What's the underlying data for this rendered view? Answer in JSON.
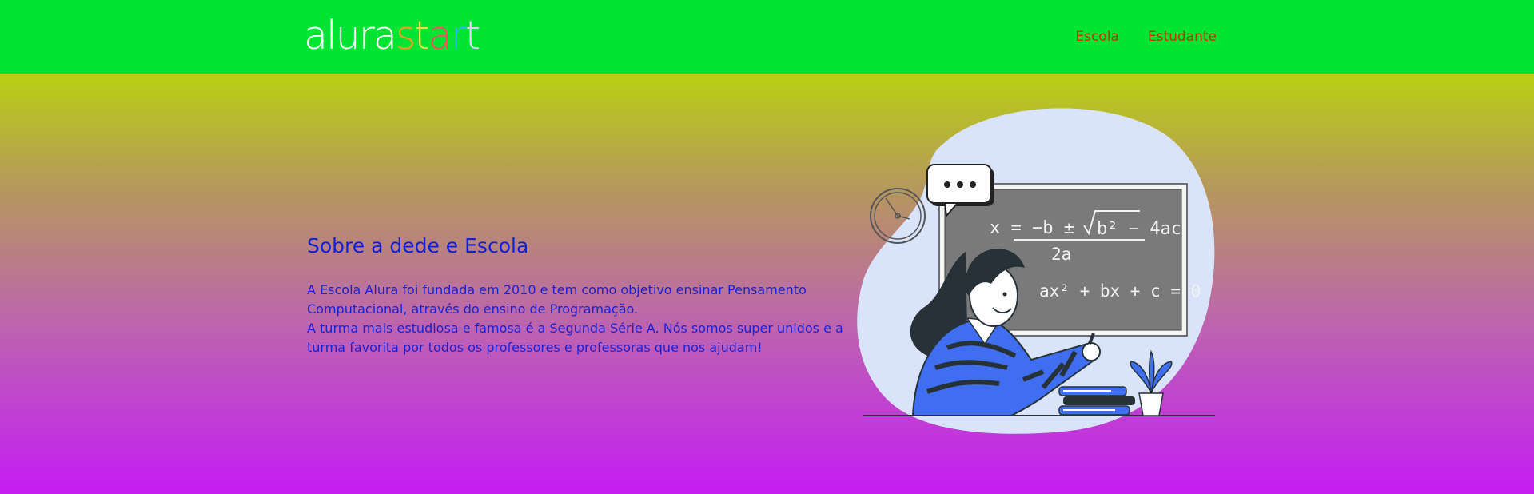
{
  "header": {
    "logo": {
      "part_white": "alura",
      "part_colored": [
        "s",
        "t",
        "a",
        "r",
        "t"
      ],
      "colors": [
        "#ff9b1f",
        "#f9e045",
        "#ff4e5e",
        "#29b6f6",
        "#e6d2ff"
      ]
    },
    "nav": [
      {
        "label": "Escola"
      },
      {
        "label": "Estudante"
      }
    ],
    "background": "#00e534"
  },
  "main": {
    "title": "Sobre a dede e Escola",
    "paragraph1": "A Escola Alura foi fundada em 2010 e tem como objetivo ensinar Pensamento Computacional, através do ensino de Programação.",
    "paragraph2": "A turma mais estudiosa e famosa é a Segunda Série A. Nós somos super unidos e a turma favorita por todos os professores e professoras que nos ajudam!",
    "text_color": "#1a22d6"
  },
  "illustration": {
    "description_icon": "teacher-at-chalkboard-illustration",
    "speech_bubble": "...",
    "formula_line1_left": "x = −b ±",
    "formula_line1_radical": "b² − 4ac",
    "formula_line2": "2a",
    "formula_line3": "ax² + bx + c = 0"
  }
}
